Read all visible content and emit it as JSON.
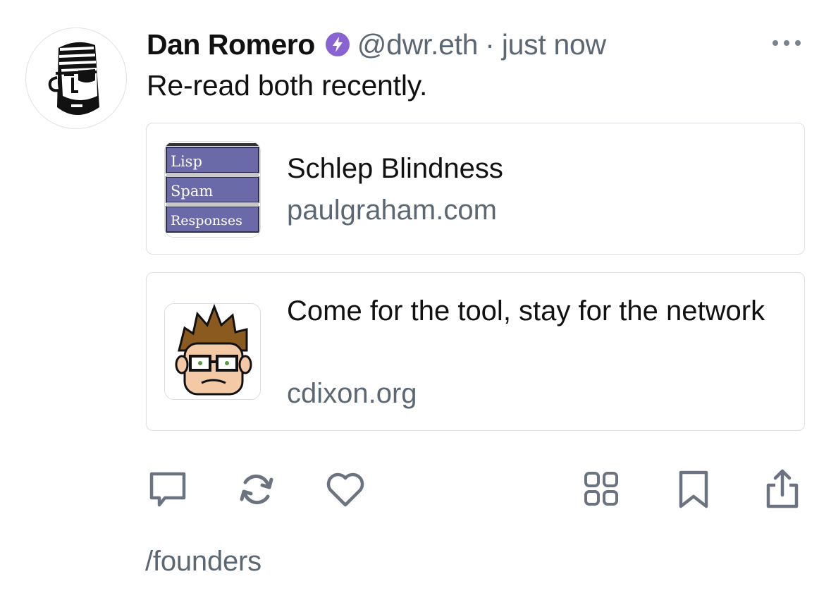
{
  "cast": {
    "author": {
      "name": "Dan Romero",
      "badge_icon": "power-badge-icon",
      "badge_color": "#8a63d2",
      "handle": "@dwr.eth",
      "separator": "·",
      "timestamp": "just now",
      "avatar_icon": "pirate-avatar-icon"
    },
    "more_icon": "more-icon",
    "text": "Re-read both recently.",
    "embeds": [
      {
        "title": "Schlep Blindness",
        "domain": "paulgraham.com",
        "thumbnail": {
          "icon": "paulgraham-menu-thumbnail",
          "items": [
            "Lisp",
            "Spam",
            "Responses"
          ]
        }
      },
      {
        "title": "Come for the tool, stay for the network",
        "domain": "cdixon.org",
        "thumbnail": {
          "icon": "cdixon-cartoon-avatar"
        }
      }
    ],
    "actions": [
      {
        "name": "reply",
        "icon": "comment-icon"
      },
      {
        "name": "recast",
        "icon": "recast-icon"
      },
      {
        "name": "like",
        "icon": "heart-icon"
      },
      {
        "name": "apps",
        "icon": "grid-icon"
      },
      {
        "name": "bookmark",
        "icon": "bookmark-icon"
      },
      {
        "name": "share",
        "icon": "share-icon"
      }
    ],
    "channel": "/founders"
  },
  "colors": {
    "text": "#111111",
    "secondary": "#5c6774",
    "icon": "#6b7280",
    "border": "#dcdfe4",
    "accent": "#8a63d2"
  }
}
